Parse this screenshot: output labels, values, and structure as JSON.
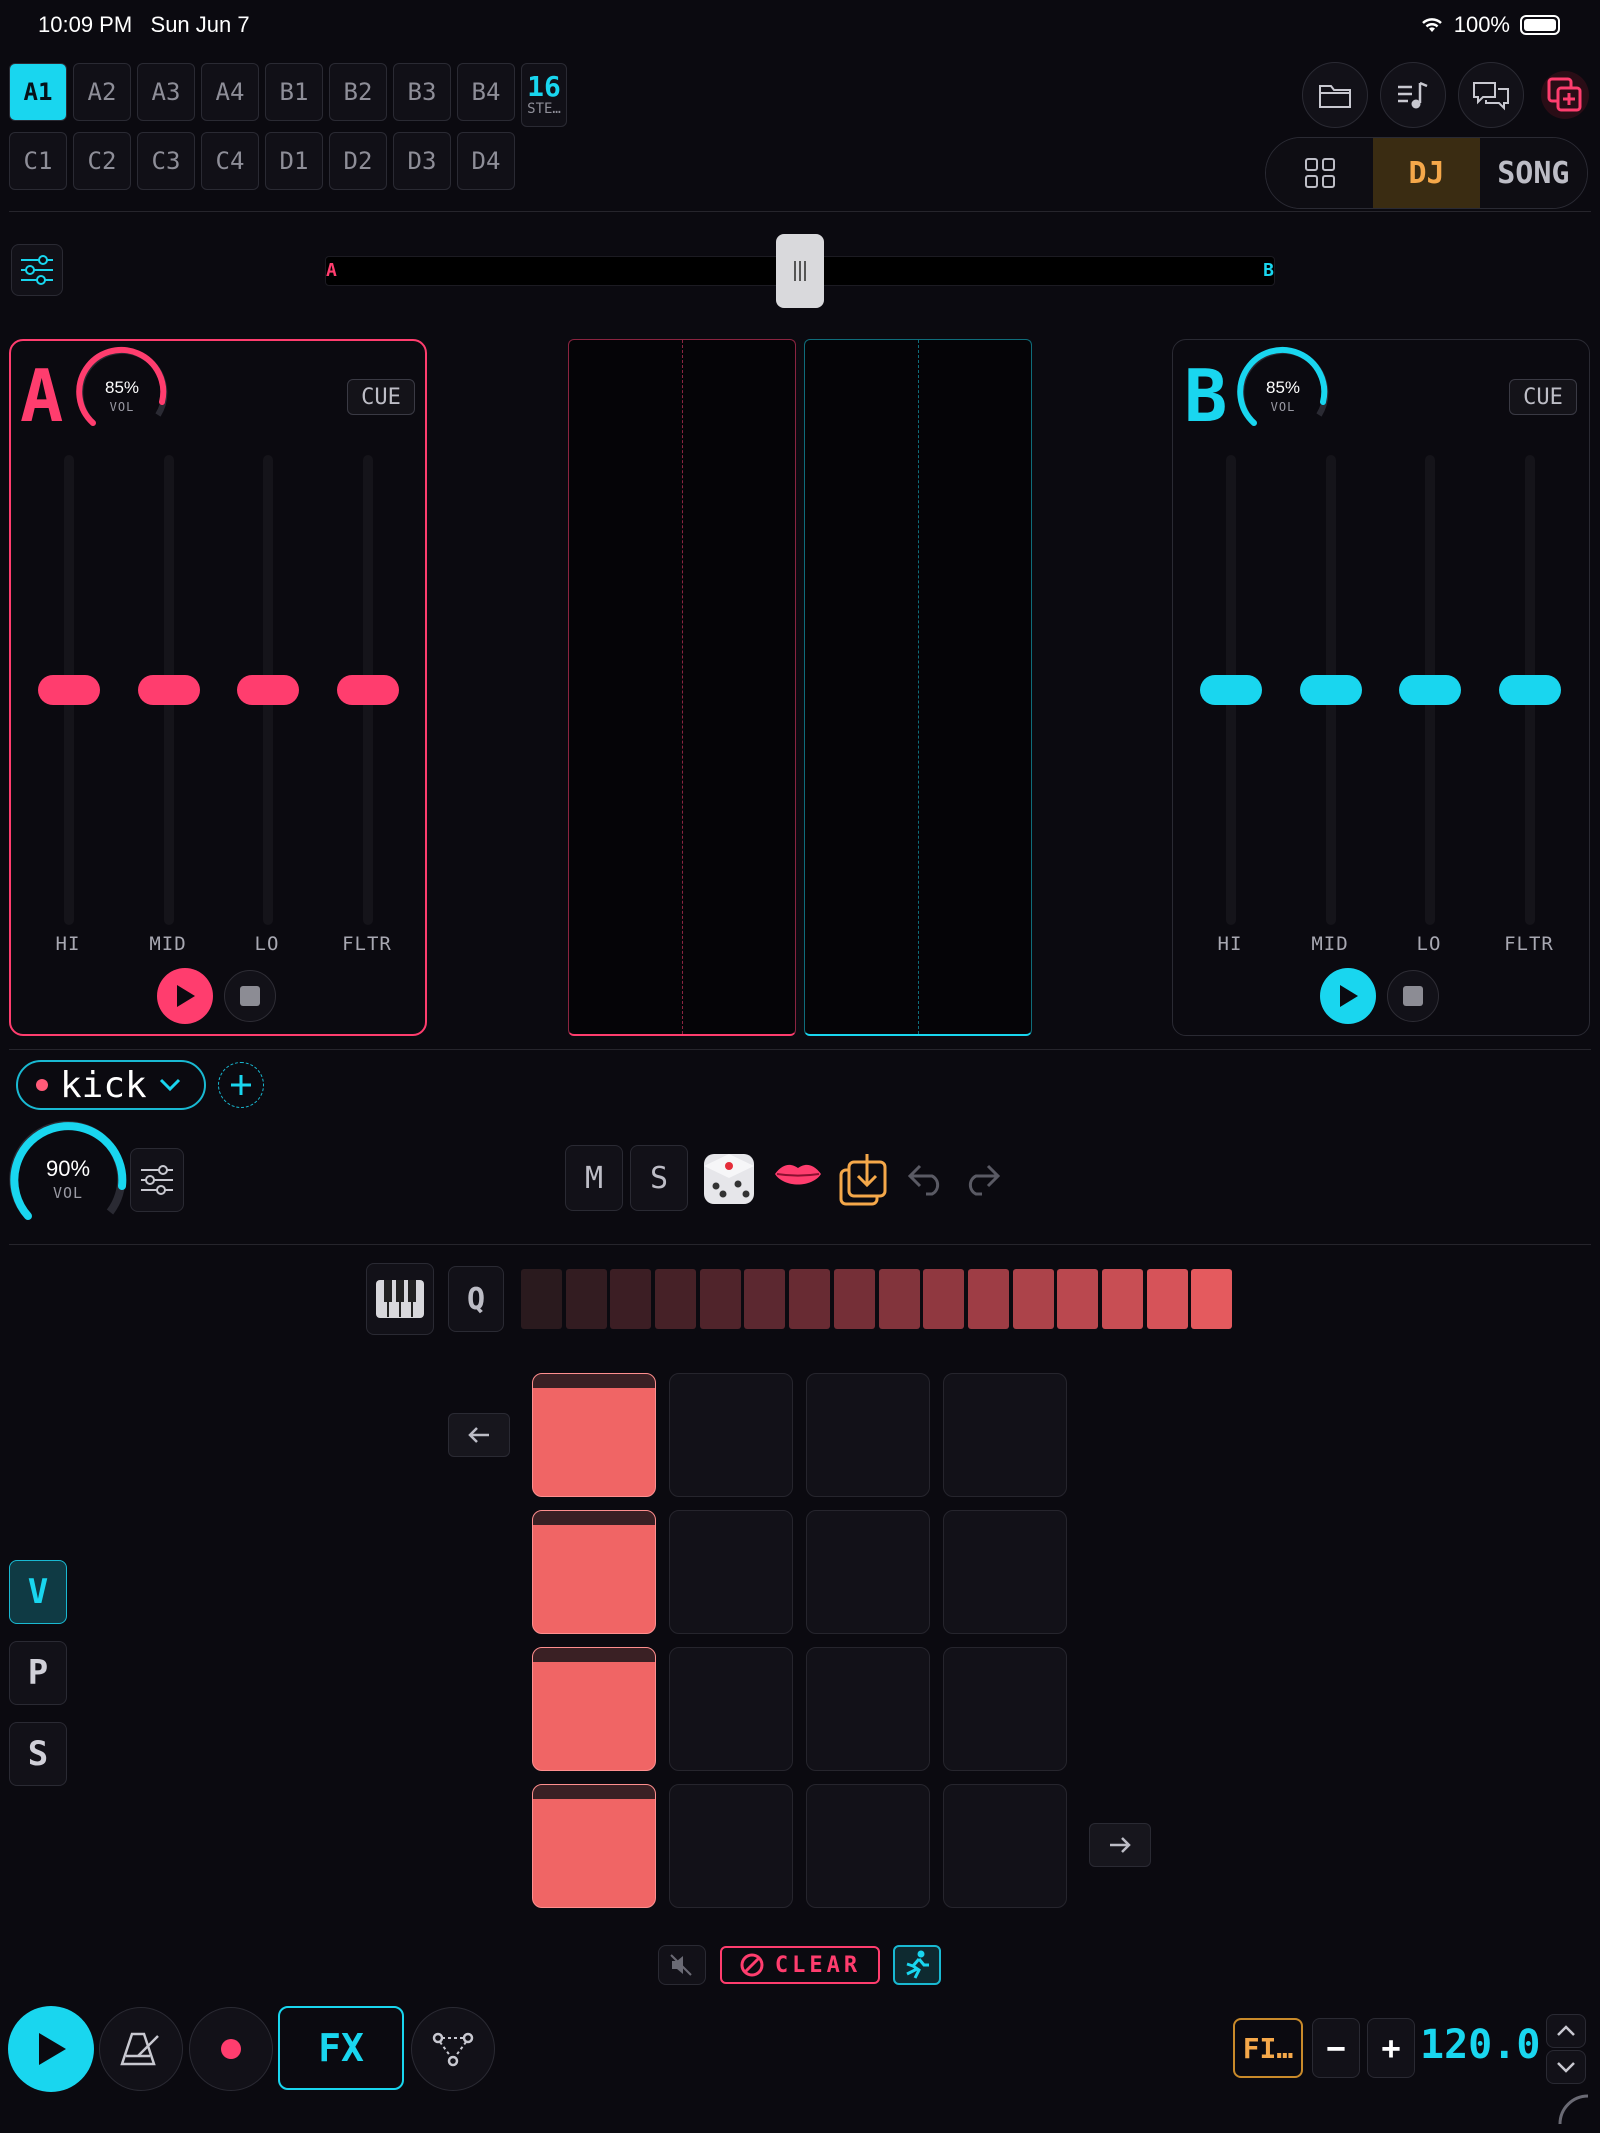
{
  "status": {
    "time": "10:09 PM",
    "date": "Sun Jun 7",
    "battery": "100%"
  },
  "patterns": {
    "row1": [
      "A1",
      "A2",
      "A3",
      "A4",
      "B1",
      "B2",
      "B3",
      "B4"
    ],
    "row2": [
      "C1",
      "C2",
      "C3",
      "C4",
      "D1",
      "D2",
      "D3",
      "D4"
    ],
    "active": "A1",
    "steps_value": "16",
    "steps_label": "STE…"
  },
  "view_mode": {
    "dj": "DJ",
    "song": "SONG",
    "active": "DJ"
  },
  "crossfader": {
    "left": "A",
    "right": "B",
    "position": 0.5
  },
  "deck_a": {
    "letter": "A",
    "volume": "85%",
    "vol_label": "VOL",
    "cue": "CUE",
    "eq": [
      "HI",
      "MID",
      "LO",
      "FLTR"
    ],
    "color": "#ff3d6e"
  },
  "deck_b": {
    "letter": "B",
    "volume": "85%",
    "vol_label": "VOL",
    "cue": "CUE",
    "eq": [
      "HI",
      "MID",
      "LO",
      "FLTR"
    ],
    "color": "#19d6ef"
  },
  "track": {
    "name": "kick",
    "volume": "90%",
    "vol_label": "VOL"
  },
  "track_tools": {
    "mute": "M",
    "solo": "S"
  },
  "quantize_label": "Q",
  "side_modes": {
    "v": "V",
    "p": "P",
    "s": "S",
    "active": "V"
  },
  "clear_label": "CLEAR",
  "transport": {
    "fx": "FX",
    "preset": "FI…",
    "minus": "−",
    "plus": "+",
    "bpm": "120.0"
  }
}
